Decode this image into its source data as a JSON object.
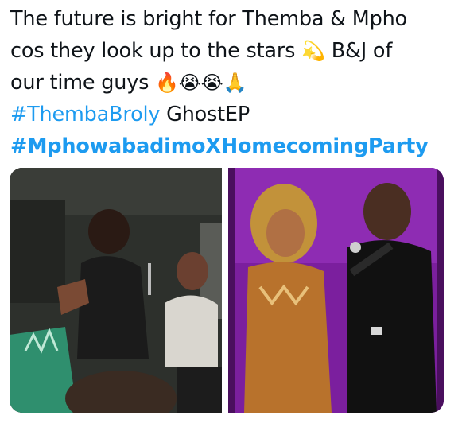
{
  "tweet": {
    "line1": "The future is bright for Themba & Mpho",
    "line2_text": "cos they look up to the stars",
    "line2_emoji": "💫",
    "line2_end": "B&J of",
    "line3_text": "our time guys",
    "line3_emojis": "🔥😭😭🙏",
    "hashtag1": "#ThembaBroly",
    "line4_end": "GhostEP",
    "hashtag2": "#MphowabadimoXHomecomingParty"
  },
  "media": {
    "photo_count": 2,
    "photos": [
      {
        "description_icon": "concert-photo-left"
      },
      {
        "description_icon": "concert-photo-right"
      }
    ]
  },
  "colors": {
    "text": "#0f1419",
    "hashtag": "#1d9bf0",
    "background": "#ffffff"
  }
}
